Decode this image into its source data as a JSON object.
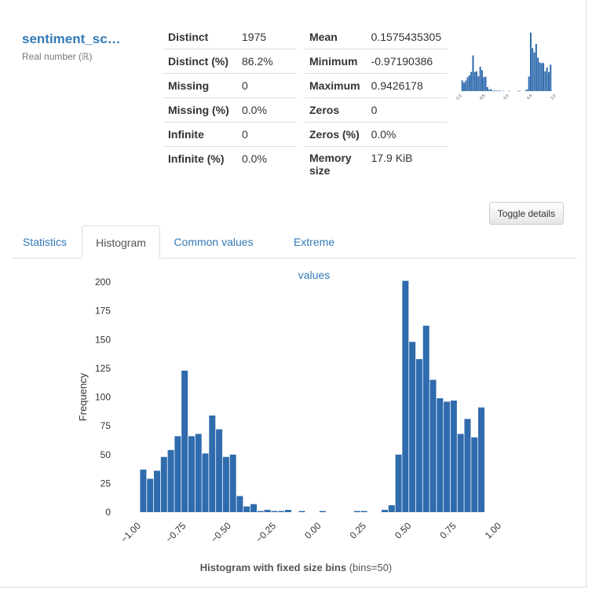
{
  "variable": {
    "name": "sentiment_sc…",
    "type": "Real number (ℝ)"
  },
  "stats_left": [
    {
      "label": "Distinct",
      "value": "1975"
    },
    {
      "label": "Distinct (%)",
      "value": "86.2%"
    },
    {
      "label": "Missing",
      "value": "0"
    },
    {
      "label": "Missing (%)",
      "value": "0.0%"
    },
    {
      "label": "Infinite",
      "value": "0"
    },
    {
      "label": "Infinite (%)",
      "value": "0.0%"
    }
  ],
  "stats_right": [
    {
      "label": "Mean",
      "value": "0.1575435305"
    },
    {
      "label": "Minimum",
      "value": "-0.97190386"
    },
    {
      "label": "Maximum",
      "value": "0.9426178"
    },
    {
      "label": "Zeros",
      "value": "0"
    },
    {
      "label": "Zeros (%)",
      "value": "0.0%"
    },
    {
      "label": "Memory size",
      "value": "17.9 KiB"
    }
  ],
  "toggle_label": "Toggle details",
  "tabs": [
    {
      "label": "Statistics",
      "active": false
    },
    {
      "label": "Histogram",
      "active": true
    },
    {
      "label": "Common values",
      "active": false
    },
    {
      "label": "Extreme values",
      "active": false
    }
  ],
  "caption": {
    "bold": "Histogram with fixed size bins",
    "normal": " (bins=50)"
  },
  "colors": {
    "bar": "#2f6bad",
    "link": "#337ab7"
  },
  "chart_data": {
    "type": "bar",
    "title": "Histogram with fixed size bins (bins=50)",
    "xlabel": "",
    "ylabel": "Frequency",
    "xlim": [
      -1.0,
      1.0
    ],
    "ylim": [
      0,
      200
    ],
    "x_ticks": [
      "−1.00",
      "−0.75",
      "−0.50",
      "−0.25",
      "0.00",
      "0.25",
      "0.50",
      "0.75",
      "1.00"
    ],
    "y_ticks": [
      "0",
      "25",
      "50",
      "75",
      "100",
      "125",
      "150",
      "175",
      "200"
    ],
    "bin_start": -0.97190386,
    "bin_end": 0.9426178,
    "values": [
      37,
      29,
      36,
      48,
      54,
      66,
      123,
      66,
      68,
      51,
      84,
      72,
      48,
      50,
      14,
      5,
      7,
      1,
      2,
      1,
      1,
      2,
      0,
      1,
      0,
      0,
      1,
      0,
      0,
      0,
      0,
      1,
      1,
      0,
      0,
      2,
      6,
      50,
      201,
      148,
      133,
      162,
      115,
      99,
      96,
      97,
      68,
      81,
      65,
      91
    ]
  },
  "mini_chart": {
    "x_ticks": [
      "-1.0",
      "-0.5",
      "0.0",
      "0.5",
      "1.0"
    ]
  }
}
